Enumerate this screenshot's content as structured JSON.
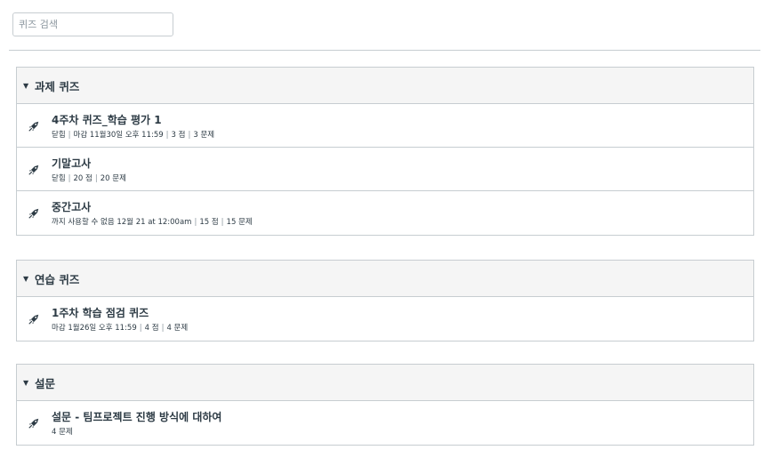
{
  "search": {
    "placeholder": "퀴즈 검색"
  },
  "groups": [
    {
      "title": "과제 퀴즈",
      "items": [
        {
          "title": "4주차 퀴즈_학습 평가 1",
          "status": "닫힘",
          "due": "마감 11월30일 오후 11:59",
          "points": "3 점",
          "questions": "3 문제"
        },
        {
          "title": "기말고사",
          "status": "닫힘",
          "points": "20 점",
          "questions": "20 문제"
        },
        {
          "title": "중간고사",
          "availability": "까지 사용할 수 없음 12월 21 at 12:00am",
          "points": "15 점",
          "questions": "15 문제"
        }
      ]
    },
    {
      "title": "연습 퀴즈",
      "items": [
        {
          "title": "1주차 학습 점검 퀴즈",
          "due": "마감 1월26일 오후 11:59",
          "points": "4 점",
          "questions": "4 문제"
        }
      ]
    },
    {
      "title": "설문",
      "items": [
        {
          "title": "설문 - 팀프로젝트 진행 방식에 대하여",
          "questions": "4 문제"
        }
      ]
    }
  ],
  "icons": {
    "group_toggle": "caret-down-icon",
    "quiz": "rocket-quiz-icon"
  },
  "colors": {
    "text": "#2d3b45",
    "border": "#c7cdd1",
    "header_bg": "#f5f5f5"
  }
}
